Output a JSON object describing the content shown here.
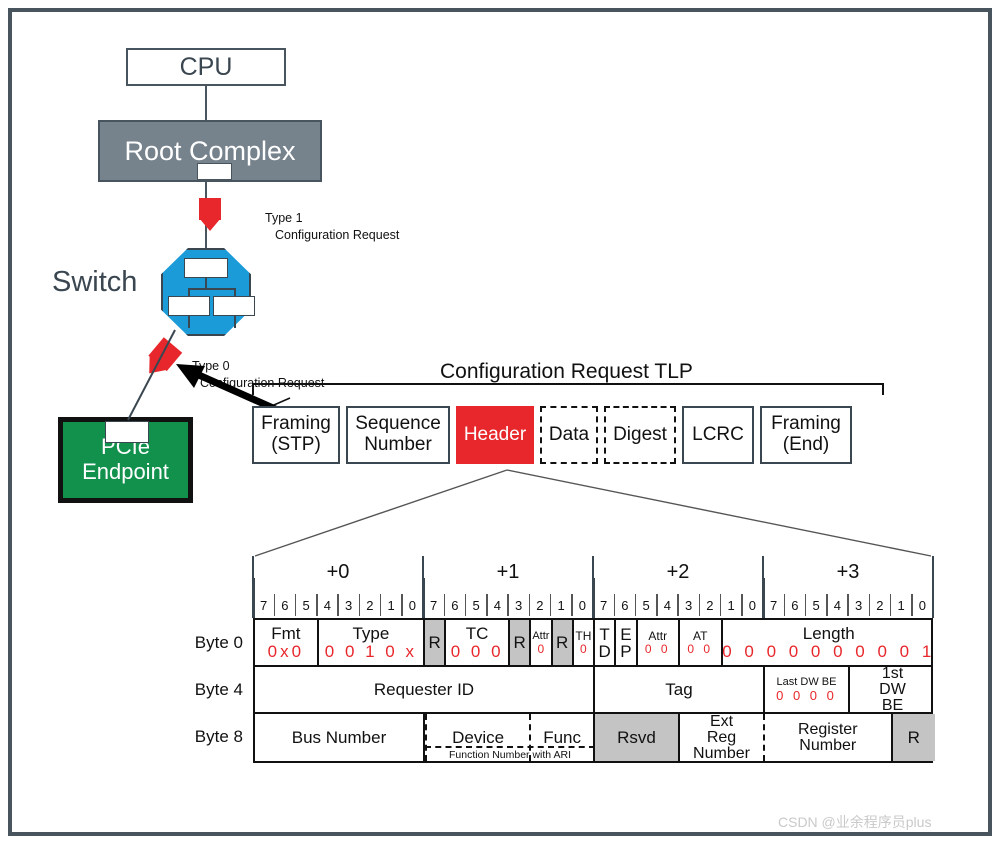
{
  "topology": {
    "cpu": "CPU",
    "root_complex": "Root Complex",
    "switch": "Switch",
    "endpoint_line1": "PCIe",
    "endpoint_line2": "Endpoint",
    "type1_line1": "Type 1",
    "type1_line2": "Configuration Request",
    "type0_line1": "Type 0",
    "type0_line2": "Configuration Request"
  },
  "tlp": {
    "title": "Configuration Request TLP",
    "cells": [
      {
        "line1": "Framing",
        "line2": "(STP)",
        "style": "solid",
        "width": 88
      },
      {
        "line1": "Sequence",
        "line2": "Number",
        "style": "solid",
        "width": 104
      },
      {
        "line1": "Header",
        "line2": "",
        "style": "header",
        "width": 78
      },
      {
        "line1": "Data",
        "line2": "",
        "style": "dashed",
        "width": 58
      },
      {
        "line1": "Digest",
        "line2": "",
        "style": "dashed",
        "width": 72
      },
      {
        "line1": "LCRC",
        "line2": "",
        "style": "solid",
        "width": 72
      },
      {
        "line1": "Framing",
        "line2": "(End)",
        "style": "solid",
        "width": 92
      }
    ]
  },
  "header_table": {
    "byte_offsets": [
      "+0",
      "+1",
      "+2",
      "+3"
    ],
    "bit_labels": [
      "7",
      "6",
      "5",
      "4",
      "3",
      "2",
      "1",
      "0"
    ],
    "row_labels": [
      "Byte 0",
      "Byte 4",
      "Byte 8"
    ],
    "rows": [
      {
        "label": "Byte 0",
        "fields": [
          {
            "name": "Fmt",
            "value": "0x0",
            "bits": 3,
            "gray": false,
            "size": "nm"
          },
          {
            "name": "Type",
            "value": "0 0 1 0 x",
            "bits": 5,
            "gray": false,
            "size": "nm"
          },
          {
            "name": "R",
            "value": "",
            "bits": 1,
            "gray": true,
            "size": "nm"
          },
          {
            "name": "TC",
            "value": "0 0 0",
            "bits": 3,
            "gray": false,
            "size": "nm"
          },
          {
            "name": "R",
            "value": "",
            "bits": 1,
            "gray": true,
            "size": "nm"
          },
          {
            "name": "Attr",
            "value": "0",
            "bits": 1,
            "gray": false,
            "size": "xs"
          },
          {
            "name": "R",
            "value": "",
            "bits": 1,
            "gray": true,
            "size": "nm"
          },
          {
            "name": "TH",
            "value": "0",
            "bits": 1,
            "gray": false,
            "size": "sm"
          },
          {
            "name": "T D",
            "value": "",
            "bits": 1,
            "gray": false,
            "size": "stack"
          },
          {
            "name": "E P",
            "value": "",
            "bits": 1,
            "gray": false,
            "size": "stack"
          },
          {
            "name": "Attr",
            "value": "0 0",
            "bits": 2,
            "gray": false,
            "size": "sm"
          },
          {
            "name": "AT",
            "value": "0 0",
            "bits": 2,
            "gray": false,
            "size": "sm"
          },
          {
            "name": "Length",
            "value": "0 0 0 0 0 0 0 0 0 1",
            "bits": 10,
            "gray": false,
            "size": "nm"
          }
        ]
      },
      {
        "label": "Byte 4",
        "fields": [
          {
            "name": "Requester ID",
            "value": "",
            "bits": 16,
            "gray": false,
            "size": "nm"
          },
          {
            "name": "Tag",
            "value": "",
            "bits": 8,
            "gray": false,
            "size": "nm"
          },
          {
            "name": "Last DW BE",
            "value": "0 0 0 0",
            "bits": 4,
            "gray": false,
            "size": "xs"
          },
          {
            "name": "1st DW BE",
            "value": "",
            "bits": 4,
            "gray": false,
            "size": "stack2"
          }
        ]
      },
      {
        "label": "Byte 8",
        "fields": [
          {
            "name": "Bus Number",
            "value": "",
            "bits": 8,
            "gray": false,
            "size": "nm"
          },
          {
            "name": "Device",
            "value": "",
            "bits": 5,
            "gray": false,
            "size": "nm"
          },
          {
            "name": "Func",
            "value": "",
            "bits": 3,
            "gray": false,
            "size": "nm"
          },
          {
            "name": "Rsvd",
            "value": "",
            "bits": 4,
            "gray": true,
            "size": "nm"
          },
          {
            "name": "Ext Reg Number",
            "value": "",
            "bits": 4,
            "gray": false,
            "size": "stack2"
          },
          {
            "name": "Register Number",
            "value": "",
            "bits": 6,
            "gray": false,
            "size": "stack2"
          },
          {
            "name": "R",
            "value": "",
            "bits": 2,
            "gray": true,
            "size": "nm"
          }
        ]
      }
    ],
    "ari_note": "Function Number with ARI"
  },
  "watermark": "CSDN @业余程序员plus",
  "colors": {
    "border": "#48545e",
    "root_complex": "#76828c",
    "switch": "#1b9bd8",
    "endpoint": "#12914d",
    "header_red": "#e8272c",
    "value_red": "#e8272c",
    "gray_field": "#c4c4c4"
  }
}
